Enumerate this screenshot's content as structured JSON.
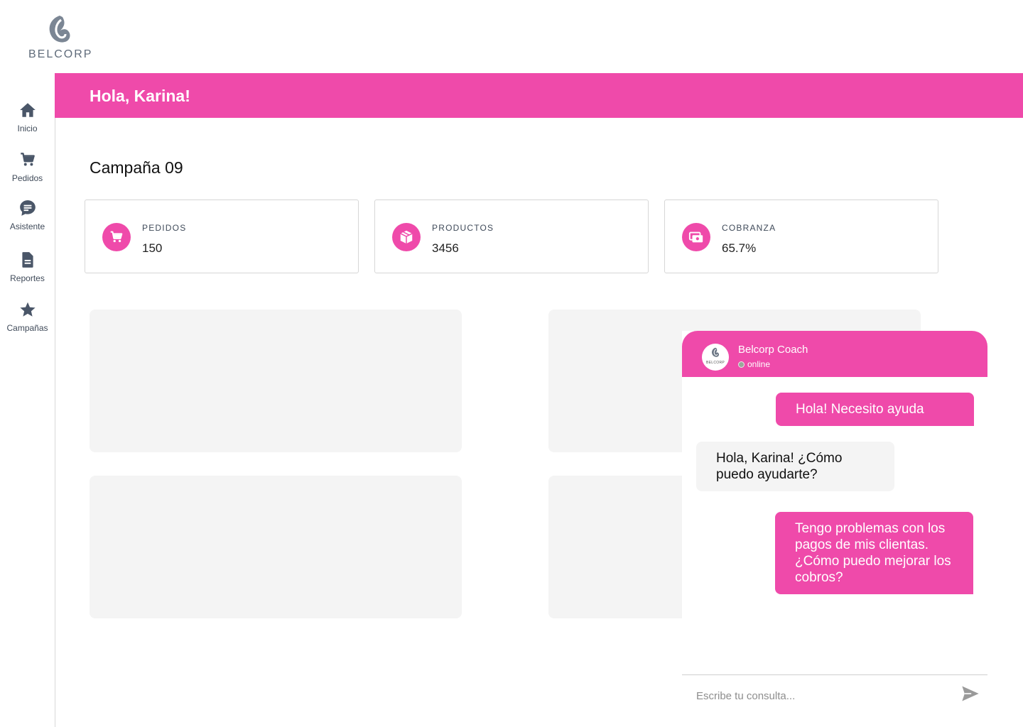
{
  "brand": {
    "logo_text": "BELCORP",
    "accent_color": "#ef4aaa"
  },
  "sidebar": {
    "items": [
      {
        "label": "Inicio",
        "icon": "home-icon"
      },
      {
        "label": "Pedidos",
        "icon": "cart-icon"
      },
      {
        "label": "Asistente",
        "icon": "chat-icon"
      },
      {
        "label": "Reportes",
        "icon": "document-icon"
      },
      {
        "label": "Campañas",
        "icon": "star-icon"
      }
    ]
  },
  "header": {
    "greeting": "Hola, Karina!"
  },
  "main": {
    "campaign_title": "Campaña 09",
    "stats": [
      {
        "label": "PEDIDOS",
        "value": "150",
        "icon": "cart-icon"
      },
      {
        "label": "PRODUCTOS",
        "value": "3456",
        "icon": "box-icon"
      },
      {
        "label": "COBRANZA",
        "value": "65.7%",
        "icon": "money-icon"
      }
    ]
  },
  "chat": {
    "avatar_text": "BELCORP",
    "title": "Belcorp Coach",
    "status": "online",
    "messages": [
      {
        "from": "user",
        "text": "Hola! Necesito ayuda"
      },
      {
        "from": "bot",
        "text": "Hola, Karina! ¿Cómo puedo ayudarte?"
      },
      {
        "from": "user",
        "text": "Tengo problemas con los pagos de mis clientas. ¿Cómo puedo mejorar los cobros?"
      }
    ],
    "input_placeholder": "Escribe tu consulta...",
    "send_icon": "send-icon"
  }
}
